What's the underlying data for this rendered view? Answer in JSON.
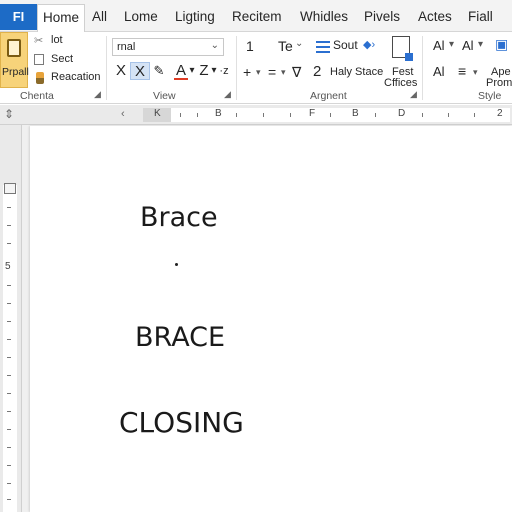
{
  "tabs": {
    "file": "FI",
    "home": "Home",
    "all": "All",
    "lome": "Lome",
    "ligting": "Ligting",
    "recitem": "Recitem",
    "whidles": "Whidles",
    "pivels": "Pivels",
    "actes": "Actes",
    "fiall": "Fiall"
  },
  "clipboard": {
    "paste_label": "Prpall",
    "cut_label": "lot",
    "copy_label": "Sect",
    "format_label": "Reacation",
    "group_label": "Chenta"
  },
  "font": {
    "font_name": "rnal",
    "group_label": "View",
    "b1": "X",
    "b2": "X",
    "b3": "A",
    "b4": "Z",
    "b5": "·z"
  },
  "paragraph": {
    "r1a": "1",
    "r1b": "Te",
    "r1c": "Sout",
    "r2a": "+",
    "r2b": "=",
    "r2c": "∇",
    "r2d": "Haly Stace",
    "fest": "Fest",
    "cffices": "Cffices",
    "group_label": "Argnent"
  },
  "styles": {
    "a1": "Al",
    "a2": "Al",
    "r2a": "Al",
    "ape": "Ape",
    "prom": "Prom",
    "group_label": "Style"
  },
  "ruler": {
    "K": "K",
    "B1": "B",
    "F": "F",
    "B2": "B",
    "D": "D",
    "two": "2",
    "vertical_five": "5"
  },
  "document": {
    "line1": "Brace",
    "line2": "BRACE",
    "line3": "CLOSING"
  }
}
